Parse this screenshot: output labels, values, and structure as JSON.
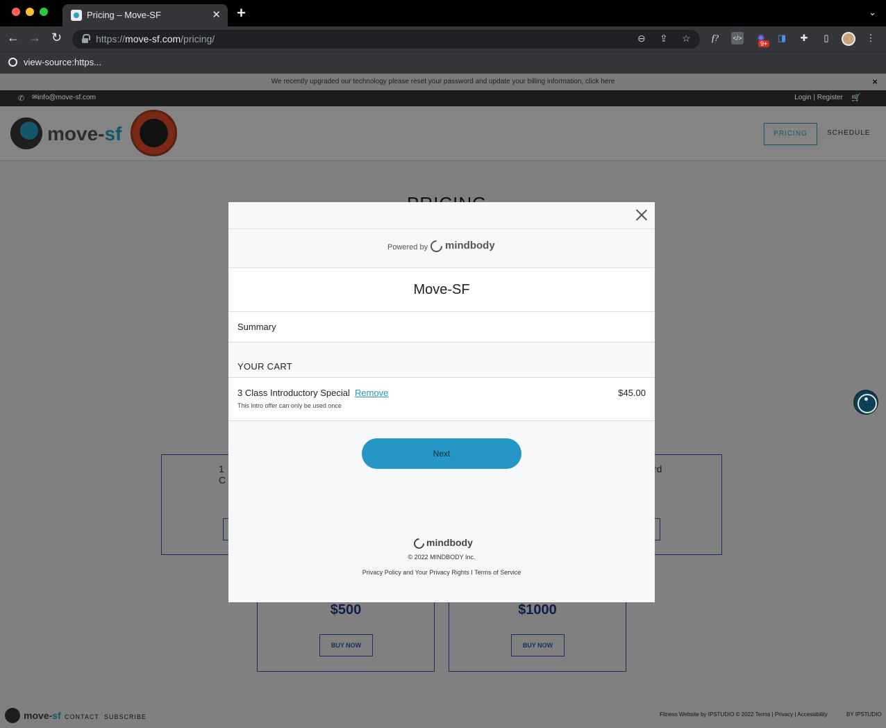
{
  "browser": {
    "tab_title": "Pricing – Move-SF",
    "new_tab": "+",
    "url_prefix": "https://",
    "url_domain": "move-sf.com",
    "url_path": "/pricing/",
    "bookmark": "view-source:https...",
    "extension_badge": "9+"
  },
  "site": {
    "notice": "We recently upgraded our technology please reset your password and update your billing information, click here",
    "notice_close": "×",
    "email": "info@move-sf.com",
    "login": "Login | Register",
    "logo_main": "move-",
    "logo_accent": "sf",
    "nav": {
      "pricing": "PRICING",
      "schedule": "SCHEDULE"
    },
    "page_heading": "PRICING",
    "card_fragment_left": "1 C",
    "card_fragment_right": "rd",
    "cards": [
      {
        "price": "$500",
        "button": "BUY NOW"
      },
      {
        "price": "$1000",
        "button": "BUY NOW"
      }
    ],
    "footer": {
      "logo_main": "move-",
      "logo_accent": "sf",
      "contact": "CONTACT",
      "subscribe": "SUBSCRIBE",
      "credit": "Fitness Website by IPSTUDIO © 2022  Terms | Privacy | Accessibility",
      "by": "BY IPSTUDIO"
    }
  },
  "modal": {
    "powered_by": "Powered by",
    "brand": "mindbody",
    "studio_name": "Move-SF",
    "summary": "Summary",
    "cart_title": "YOUR CART",
    "item": {
      "name": "3 Class Introductory Special",
      "remove": "Remove",
      "price": "$45.00",
      "note": "This intro offer can only be used once"
    },
    "next": "Next",
    "footer_brand": "mindbody",
    "copyright": "© 2022 MINDBODY Inc.",
    "legal": "Privacy Policy and Your Privacy Rights I Terms of Service"
  },
  "colors": {
    "accent": "#2497c7",
    "brand_teal": "#15576a",
    "card_navy": "#1a2e5e"
  }
}
